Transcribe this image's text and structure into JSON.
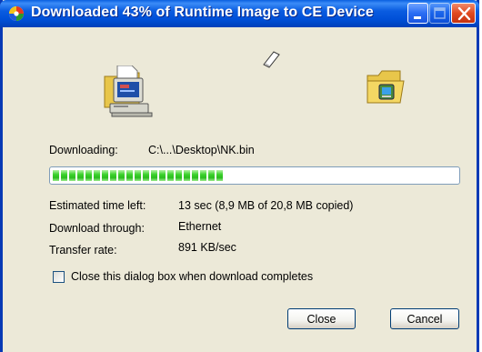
{
  "window": {
    "title": "Downloaded 43% of Runtime Image to CE Device",
    "accent_color": "#0a5ce0",
    "close_button_color": "#e04a20"
  },
  "transfer": {
    "downloading_label": "Downloading:",
    "downloading_value": "C:\\...\\Desktop\\NK.bin",
    "progress_fraction": 0.43,
    "progress_color": "#2bbd1e",
    "rows": [
      {
        "label": "Estimated time left:",
        "value": "13 sec (8,9 MB of 20,8 MB copied)"
      },
      {
        "label": "Download through:",
        "value": "Ethernet"
      },
      {
        "label": "Transfer rate:",
        "value": "891 KB/sec"
      }
    ]
  },
  "options": {
    "close_on_complete_label": "Close this dialog box when download completes",
    "close_on_complete_checked": false
  },
  "buttons": {
    "close_label": "Close",
    "cancel_label": "Cancel"
  },
  "icons": {
    "title": "app-icon",
    "source": "computer-icon",
    "flying": "paper-icon",
    "destination": "folder-device-icon"
  }
}
